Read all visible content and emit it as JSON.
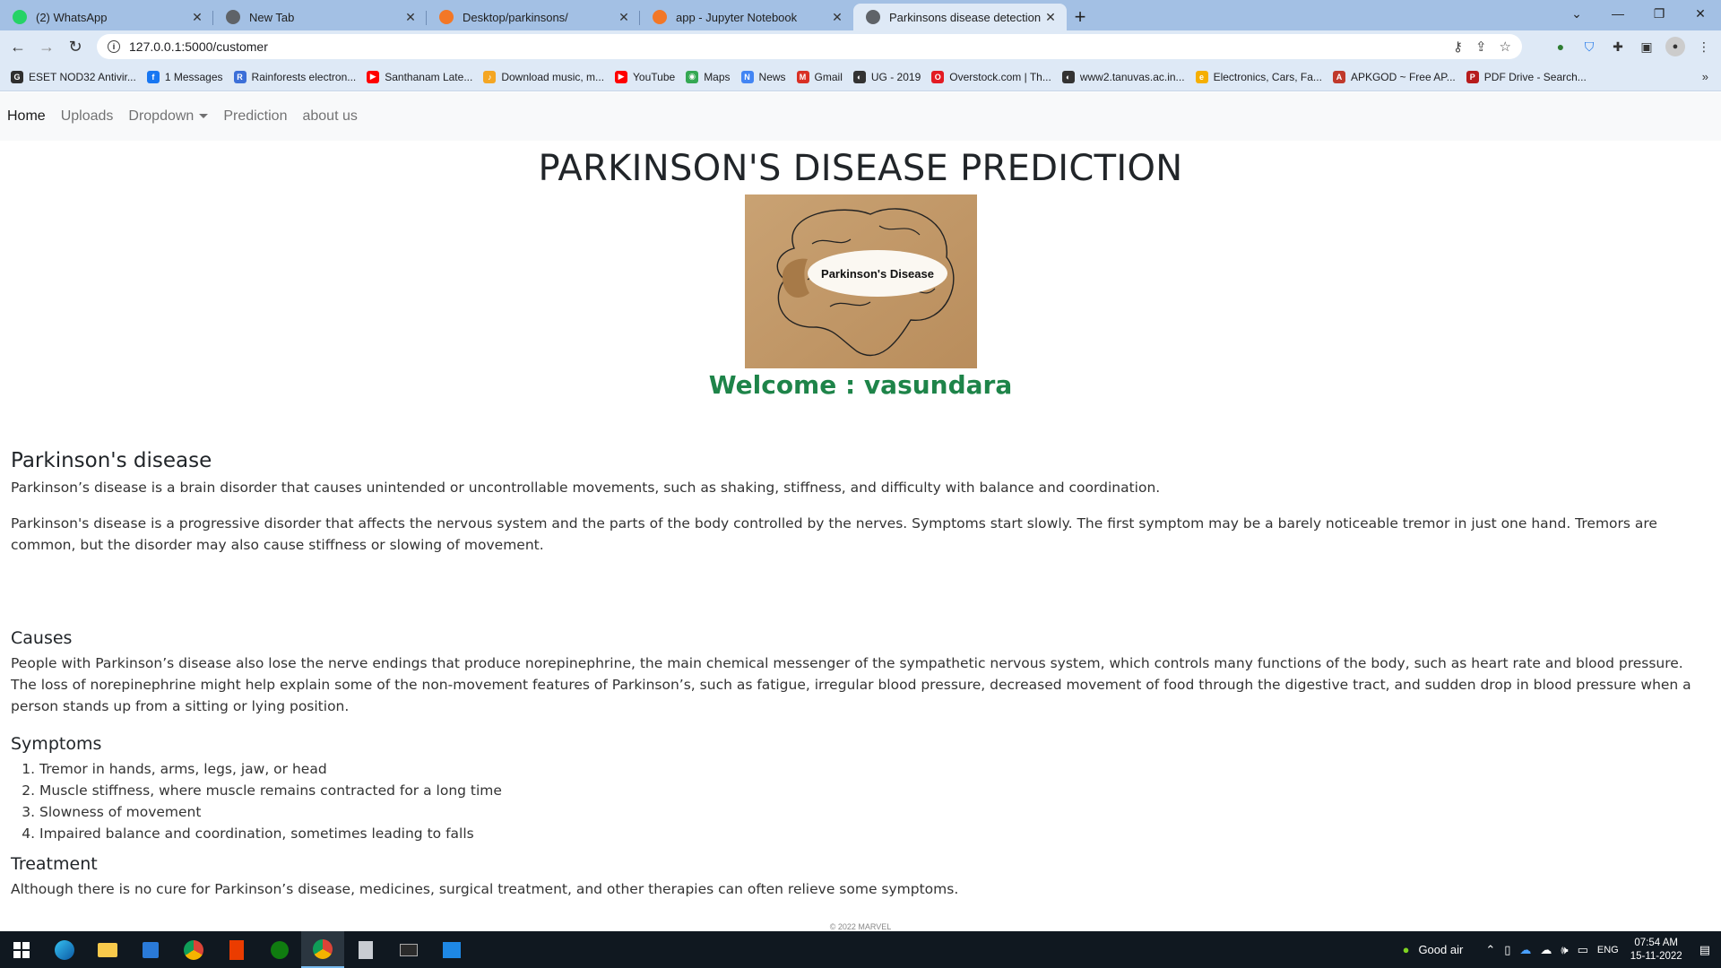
{
  "browser": {
    "tabs": [
      {
        "label": "(2) WhatsApp",
        "icon": "whatsapp-icon",
        "color": "#25d366",
        "active": false
      },
      {
        "label": "New Tab",
        "icon": "globe-icon",
        "color": "#5f6368",
        "active": false
      },
      {
        "label": "Desktop/parkinsons/",
        "icon": "jupyter-loading-icon",
        "color": "#f37726",
        "active": false
      },
      {
        "label": "app - Jupyter Notebook",
        "icon": "jupyter-icon",
        "color": "#f37726",
        "active": false
      },
      {
        "label": "Parkinsons disease detection",
        "icon": "globe-icon",
        "color": "#5f6368",
        "active": true
      }
    ],
    "url": "127.0.0.1:5000/customer",
    "bookmarks": [
      {
        "label": "ESET NOD32 Antivir...",
        "color": "#2f2f2f",
        "glyph": "G"
      },
      {
        "label": "1 Messages",
        "color": "#1877f2",
        "glyph": "f"
      },
      {
        "label": "Rainforests electron...",
        "color": "#3c6fd8",
        "glyph": "R"
      },
      {
        "label": "Santhanam Late...",
        "color": "#ff0000",
        "glyph": "▶"
      },
      {
        "label": "Download music, m...",
        "color": "#f4a623",
        "glyph": "♪"
      },
      {
        "label": "YouTube",
        "color": "#ff0000",
        "glyph": "▶"
      },
      {
        "label": "Maps",
        "color": "#34a853",
        "glyph": "◉"
      },
      {
        "label": "News",
        "color": "#4285f4",
        "glyph": "N"
      },
      {
        "label": "Gmail",
        "color": "#d93025",
        "glyph": "M"
      },
      {
        "label": "UG - 2019",
        "color": "#333333",
        "glyph": "◐"
      },
      {
        "label": "Overstock.com | Th...",
        "color": "#e31b23",
        "glyph": "O"
      },
      {
        "label": "www2.tanuvas.ac.in...",
        "color": "#333333",
        "glyph": "◐"
      },
      {
        "label": "Electronics, Cars, Fa...",
        "color": "#f5af02",
        "glyph": "e"
      },
      {
        "label": "APKGOD ~ Free AP...",
        "color": "#c0392b",
        "glyph": "A"
      },
      {
        "label": "PDF Drive - Search...",
        "color": "#b71c1c",
        "glyph": "P"
      }
    ]
  },
  "site": {
    "nav": [
      {
        "label": "Home",
        "active": true
      },
      {
        "label": "Uploads",
        "active": false
      },
      {
        "label": "Dropdown",
        "active": false,
        "dropdown": true
      },
      {
        "label": "Prediction",
        "active": false
      },
      {
        "label": "about us",
        "active": false
      }
    ],
    "title": "PARKINSON'S DISEASE PREDICTION",
    "image_caption": "Parkinson's Disease",
    "welcome": "Welcome : vasundara",
    "welcome_color": "#1e8449",
    "sections": {
      "intro_heading": "Parkinson's disease",
      "intro_p1": "Parkinson’s disease is a brain disorder that causes unintended or uncontrollable movements, such as shaking, stiffness, and difficulty with balance and coordination.",
      "intro_p2": "Parkinson's disease is a progressive disorder that affects the nervous system and the parts of the body controlled by the nerves. Symptoms start slowly. The first symptom may be a barely noticeable tremor in just one hand. Tremors are common, but the disorder may also cause stiffness or slowing of movement.",
      "causes_heading": "Causes",
      "causes_text": "People with Parkinson’s disease also lose the nerve endings that produce norepinephrine, the main chemical messenger of the sympathetic nervous system, which controls many functions of the body, such as heart rate and blood pressure. The loss of norepinephrine might help explain some of the non-movement features of Parkinson’s, such as fatigue, irregular blood pressure, decreased movement of food through the digestive tract, and sudden drop in blood pressure when a person stands up from a sitting or lying position.",
      "symptoms_heading": "Symptoms",
      "symptoms": [
        "Tremor in hands, arms, legs, jaw, or head",
        "Muscle stiffness, where muscle remains contracted for a long time",
        "Slowness of movement",
        "Impaired balance and coordination, sometimes leading to falls"
      ],
      "treatment_heading": "Treatment",
      "treatment_text": "Although there is no cure for Parkinson’s disease, medicines, surgical treatment, and other therapies can often relieve some symptoms."
    },
    "footer": "© 2022 MARVEL"
  },
  "taskbar": {
    "weather": "Good air",
    "language": "ENG",
    "time": "07:54 AM",
    "date": "15-11-2022"
  }
}
